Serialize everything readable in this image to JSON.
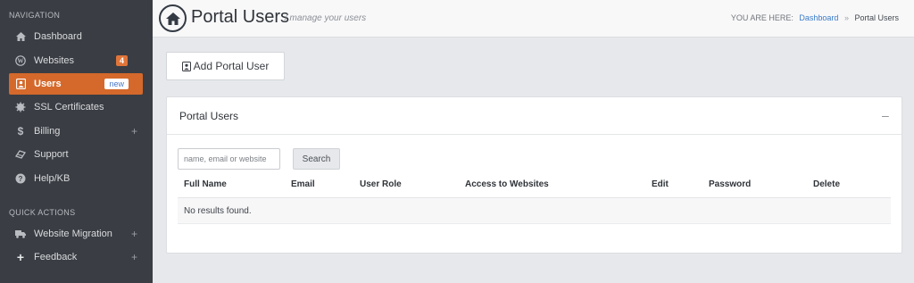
{
  "sidebar": {
    "navigation_title": "NAVIGATION",
    "items": [
      {
        "label": "Dashboard",
        "icon": "dashboard-icon"
      },
      {
        "label": "Websites",
        "badge": "4",
        "icon": "wordpress-icon"
      },
      {
        "label": "Users",
        "badge": "new",
        "icon": "user-icon"
      },
      {
        "label": "SSL Certificates",
        "icon": "certificate-icon"
      },
      {
        "label": "Billing",
        "icon": "dollar-icon"
      },
      {
        "label": "Support",
        "icon": "support-icon"
      },
      {
        "label": "Help/KB",
        "icon": "help-icon"
      }
    ],
    "quick_actions_title": "QUICK ACTIONS",
    "quick_actions": [
      {
        "label": "Website Migration",
        "icon": "truck-icon"
      },
      {
        "label": "Feedback",
        "icon": "plus-icon"
      }
    ]
  },
  "header": {
    "title": "Portal Users",
    "subtitle": "/  manage your users",
    "breadcrumb_prefix": "YOU ARE HERE:",
    "breadcrumb_link": "Dashboard",
    "breadcrumb_separator": "»",
    "breadcrumb_current": "Portal Users"
  },
  "actions": {
    "add_label": "Add Portal User"
  },
  "panel": {
    "title": "Portal Users",
    "search_placeholder": "name, email or website",
    "search_button": "Search",
    "columns": [
      "Full Name",
      "Email",
      "User Role",
      "Access to Websites",
      "Edit",
      "Password",
      "Delete"
    ],
    "empty_message": "No results found."
  },
  "colors": {
    "sidebar_bg": "#3a3d43",
    "accent": "#d4692b",
    "link": "#3a7bc8"
  }
}
